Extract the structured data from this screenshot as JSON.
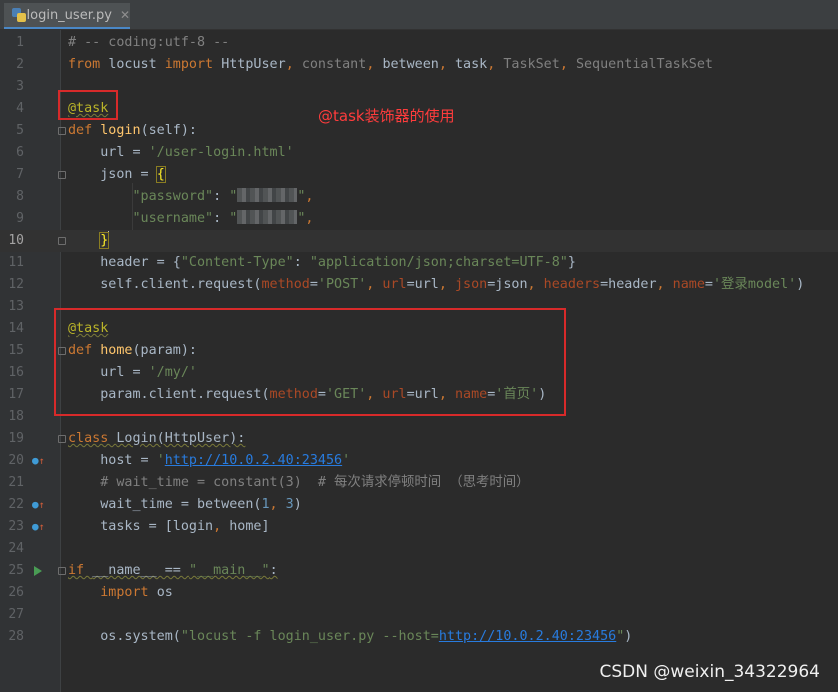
{
  "tab": {
    "label": "login_user.py",
    "close": "✕"
  },
  "current_line": 10,
  "annotation": "@task装饰器的使用",
  "watermark": "CSDN @weixin_34322964",
  "lines": [
    {
      "n": "1",
      "parts": [
        [
          "# -- coding:utf-8 --",
          "cm"
        ]
      ]
    },
    {
      "n": "2",
      "parts": [
        [
          "from ",
          "kw"
        ],
        [
          "locust ",
          ""
        ],
        [
          "import ",
          "kw"
        ],
        [
          "HttpUser",
          ""
        ],
        [
          ", ",
          "kw"
        ],
        [
          "constant",
          "dim"
        ],
        [
          ", ",
          "kw"
        ],
        [
          "between",
          ""
        ],
        [
          ", ",
          "kw"
        ],
        [
          "task",
          ""
        ],
        [
          ", ",
          "kw"
        ],
        [
          "TaskSet",
          "dim"
        ],
        [
          ", ",
          "kw"
        ],
        [
          "SequentialTaskSet",
          "dim"
        ]
      ]
    },
    {
      "n": "3",
      "parts": []
    },
    {
      "n": "4",
      "parts": [
        [
          "@task",
          "dec sq"
        ]
      ]
    },
    {
      "n": "5",
      "parts": [
        [
          "def ",
          "kw"
        ],
        [
          "login",
          "fn"
        ],
        [
          "(self):",
          ""
        ]
      ]
    },
    {
      "n": "6",
      "parts": [
        [
          "    url = ",
          ""
        ],
        [
          "'/user-login.html'",
          "str"
        ]
      ]
    },
    {
      "n": "7",
      "parts": [
        [
          "    json = ",
          ""
        ],
        [
          "{",
          "brk"
        ]
      ]
    },
    {
      "n": "8",
      "parts": [
        [
          "        ",
          ""
        ],
        [
          "\"password\"",
          "str"
        ],
        [
          ": ",
          ""
        ],
        [
          "\"",
          "str"
        ],
        [
          "#BLUR#",
          ""
        ],
        [
          "\"",
          "str"
        ],
        [
          ",",
          "kw"
        ]
      ]
    },
    {
      "n": "9",
      "parts": [
        [
          "        ",
          ""
        ],
        [
          "\"username\"",
          "str"
        ],
        [
          ": ",
          ""
        ],
        [
          "\"",
          "str"
        ],
        [
          "#BLUR#",
          ""
        ],
        [
          "\"",
          "str"
        ],
        [
          ",",
          "kw"
        ]
      ]
    },
    {
      "n": "10",
      "parts": [
        [
          "    ",
          ""
        ],
        [
          "}",
          "brk"
        ],
        [
          "#CARET#",
          ""
        ]
      ]
    },
    {
      "n": "11",
      "parts": [
        [
          "    header = {",
          ""
        ],
        [
          "\"Content-Type\"",
          "str"
        ],
        [
          ": ",
          ""
        ],
        [
          "\"application/json;charset=UTF-8\"",
          "str"
        ],
        [
          "}",
          ""
        ]
      ]
    },
    {
      "n": "12",
      "parts": [
        [
          "    self.client.request(",
          ""
        ],
        [
          "method",
          "pm"
        ],
        [
          "=",
          ""
        ],
        [
          "'POST'",
          "str"
        ],
        [
          ", ",
          "kw"
        ],
        [
          "url",
          "pm"
        ],
        [
          "=url",
          ""
        ],
        [
          ", ",
          "kw"
        ],
        [
          "json",
          "pm"
        ],
        [
          "=json",
          ""
        ],
        [
          ", ",
          "kw"
        ],
        [
          "headers",
          "pm"
        ],
        [
          "=header",
          ""
        ],
        [
          ", ",
          "kw"
        ],
        [
          "name",
          "pm"
        ],
        [
          "=",
          ""
        ],
        [
          "'登录model'",
          "str"
        ],
        [
          ")",
          ""
        ]
      ]
    },
    {
      "n": "13",
      "parts": []
    },
    {
      "n": "14",
      "parts": [
        [
          "@task",
          "dec sq"
        ]
      ]
    },
    {
      "n": "15",
      "parts": [
        [
          "def ",
          "kw"
        ],
        [
          "home",
          "fn"
        ],
        [
          "(param):",
          ""
        ]
      ]
    },
    {
      "n": "16",
      "parts": [
        [
          "    url = ",
          ""
        ],
        [
          "'/my/'",
          "str"
        ]
      ]
    },
    {
      "n": "17",
      "parts": [
        [
          "    param.client.request(",
          ""
        ],
        [
          "method",
          "pm"
        ],
        [
          "=",
          ""
        ],
        [
          "'GET'",
          "str"
        ],
        [
          ", ",
          "kw"
        ],
        [
          "url",
          "pm"
        ],
        [
          "=url",
          ""
        ],
        [
          ", ",
          "kw"
        ],
        [
          "name",
          "pm"
        ],
        [
          "=",
          ""
        ],
        [
          "'首页'",
          "str"
        ],
        [
          ")",
          ""
        ]
      ]
    },
    {
      "n": "18",
      "parts": []
    },
    {
      "n": "19",
      "parts": [
        [
          "class ",
          "kw sq"
        ],
        [
          "Login(HttpUser):",
          "sq"
        ]
      ]
    },
    {
      "n": "20",
      "parts": [
        [
          "    host = ",
          ""
        ],
        [
          "'",
          "str"
        ],
        [
          "http://10.0.2.40:23456",
          "lnk"
        ],
        [
          "'",
          "str"
        ]
      ]
    },
    {
      "n": "21",
      "parts": [
        [
          "    # wait_time = constant(3)  # 每次请求停顿时间 （思考时间）",
          "cm"
        ]
      ]
    },
    {
      "n": "22",
      "parts": [
        [
          "    wait_time = between(",
          ""
        ],
        [
          "1",
          "num"
        ],
        [
          ", ",
          "kw"
        ],
        [
          "3",
          "num"
        ],
        [
          ")",
          ""
        ]
      ]
    },
    {
      "n": "23",
      "parts": [
        [
          "    tasks = [login",
          ""
        ],
        [
          ", ",
          "kw"
        ],
        [
          "home]",
          ""
        ]
      ]
    },
    {
      "n": "24",
      "parts": []
    },
    {
      "n": "25",
      "parts": [
        [
          "if ",
          "kw sq"
        ],
        [
          "__name__ == ",
          "sq"
        ],
        [
          "\"__main__\"",
          "str sq"
        ],
        [
          ":",
          "sq"
        ]
      ]
    },
    {
      "n": "26",
      "parts": [
        [
          "    ",
          ""
        ],
        [
          "import ",
          "kw"
        ],
        [
          "os",
          ""
        ]
      ]
    },
    {
      "n": "27",
      "parts": []
    },
    {
      "n": "28",
      "parts": [
        [
          "    os.system(",
          ""
        ],
        [
          "\"locust -f login_user.py --host=",
          "str"
        ],
        [
          "http://10.0.2.40:23456",
          "lnk"
        ],
        [
          "\"",
          "str"
        ],
        [
          ")",
          ""
        ]
      ]
    }
  ]
}
